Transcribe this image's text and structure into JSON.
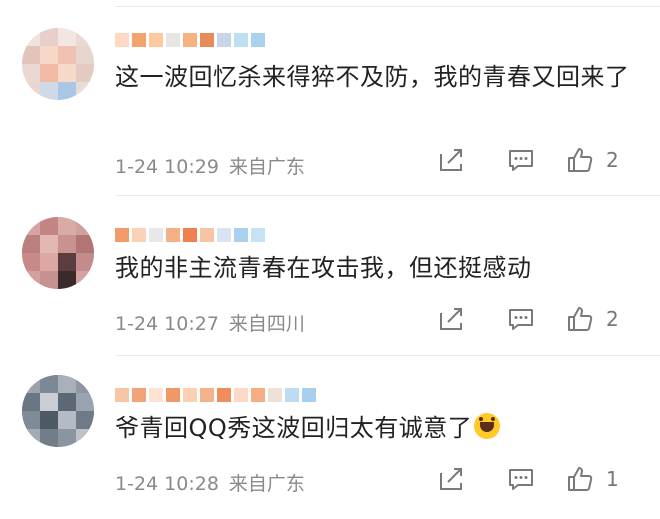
{
  "comments": [
    {
      "text": "这一波回忆杀来得猝不及防，我的青春又回来了",
      "time": "1-24 10:29",
      "source": "来自广东",
      "likes": "2",
      "name_colors": [
        "#ffd7c2",
        "#f4a36e",
        "#ffc89e",
        "#e6e6e6",
        "#f7b07e",
        "#e58a58",
        "#c9d6ea",
        "#bfe0f2",
        "#a8d2ee"
      ]
    },
    {
      "text": "我的非主流青春在攻击我，但还挺感动",
      "time": "1-24 10:27",
      "source": "来自四川",
      "likes": "2",
      "name_colors": [
        "#f39a6a",
        "#fbd2b8",
        "#e8e8e8",
        "#f4b188",
        "#ef8050",
        "#f7c4a4",
        "#d9e4f2",
        "#a9d0ee",
        "#c6e2f4"
      ]
    },
    {
      "text": "爷青回QQ秀这波回归太有诚意了",
      "time": "1-24 10:28",
      "source": "来自广东",
      "likes": "1",
      "name_colors": [
        "#f7c6a6",
        "#f1a478",
        "#fde3d3",
        "#f09866",
        "#fcd0b2",
        "#f4b38c",
        "#ef8d5c",
        "#fbd9c4",
        "#f7ad82",
        "#eee2d8",
        "#bcdcf2",
        "#a7cff0"
      ]
    }
  ],
  "icons": {
    "share": "share-icon",
    "comment": "comment-icon",
    "like": "thumbs-up-icon",
    "emoji": "laughing-emoji-icon"
  }
}
